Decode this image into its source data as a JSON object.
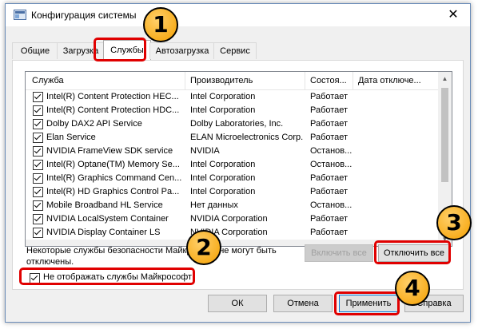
{
  "window": {
    "title": "Конфигурация системы",
    "close_glyph": "✕"
  },
  "tabs": [
    {
      "label": "Общие"
    },
    {
      "label": "Загрузка"
    },
    {
      "label": "Службы"
    },
    {
      "label": "Автозагрузка"
    },
    {
      "label": "Сервис"
    }
  ],
  "active_tab": "Службы",
  "columns": [
    "Служба",
    "Производитель",
    "Состоя...",
    "Дата отключе..."
  ],
  "services": [
    {
      "name": "Intel(R) Content Protection HEC...",
      "vendor": "Intel Corporation",
      "status": "Работает",
      "checked": true
    },
    {
      "name": "Intel(R) Content Protection HDC...",
      "vendor": "Intel Corporation",
      "status": "Работает",
      "checked": true
    },
    {
      "name": "Dolby DAX2 API Service",
      "vendor": "Dolby Laboratories, Inc.",
      "status": "Работает",
      "checked": true
    },
    {
      "name": "Elan Service",
      "vendor": "ELAN Microelectronics Corp.",
      "status": "Работает",
      "checked": true
    },
    {
      "name": "NVIDIA FrameView SDK service",
      "vendor": "NVIDIA",
      "status": "Останов...",
      "checked": true
    },
    {
      "name": "Intel(R) Optane(TM) Memory Se...",
      "vendor": "Intel Corporation",
      "status": "Останов...",
      "checked": true
    },
    {
      "name": "Intel(R) Graphics Command Cen...",
      "vendor": "Intel Corporation",
      "status": "Работает",
      "checked": true
    },
    {
      "name": "Intel(R) HD Graphics Control Pa...",
      "vendor": "Intel Corporation",
      "status": "Работает",
      "checked": true
    },
    {
      "name": "Mobile Broadband HL Service",
      "vendor": "Нет данных",
      "status": "Останов...",
      "checked": true
    },
    {
      "name": "NVIDIA LocalSystem Container",
      "vendor": "NVIDIA Corporation",
      "status": "Работает",
      "checked": true
    },
    {
      "name": "NVIDIA Display Container LS",
      "vendor": "NVIDIA Corporation",
      "status": "Работает",
      "checked": true
    }
  ],
  "note": "Некоторые службы безопасности Майкрософт не могут быть отключены.",
  "hide_ms_label": "Не отображать службы Майкрософт",
  "hide_ms_checked": true,
  "buttons": {
    "enable_all": "Включить все",
    "disable_all": "Отключить все",
    "ok": "ОК",
    "cancel": "Отмена",
    "apply": "Применить",
    "help": "Справка"
  },
  "badges": [
    "1",
    "2",
    "3",
    "4"
  ],
  "colors": {
    "highlight": "#e00000",
    "badge": "#f5a000",
    "accent": "#0078d7"
  }
}
